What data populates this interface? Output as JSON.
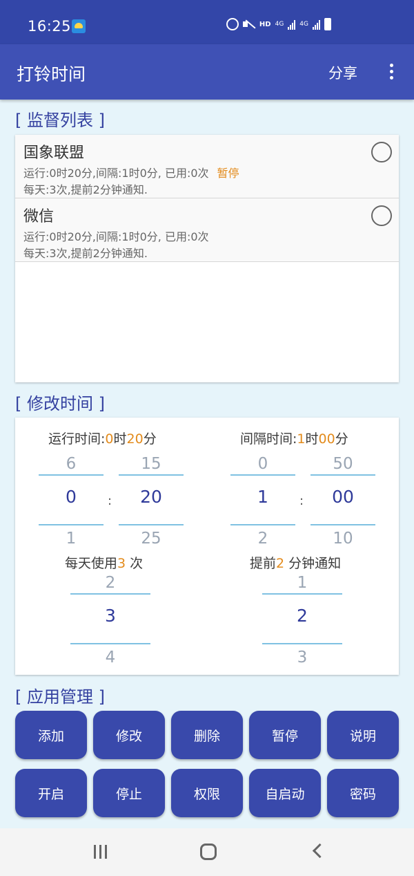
{
  "status_bar": {
    "time": "16:25",
    "hd": "HD",
    "net1": "4G",
    "net2": "4G"
  },
  "app_bar": {
    "title": "打铃时间",
    "share": "分享"
  },
  "monitor": {
    "title": "[ 监督列表 ]",
    "items": [
      {
        "name": "国象联盟",
        "line1": "运行:0时20分,间隔:1时0分, 已用:0次",
        "status": "暂停",
        "line2": "每天:3次,提前2分钟通知."
      },
      {
        "name": "微信",
        "line1": "运行:0时20分,间隔:1时0分, 已用:0次",
        "status": "",
        "line2": "每天:3次,提前2分钟通知."
      }
    ]
  },
  "edit": {
    "title": "[ 修改时间 ]",
    "run": {
      "label": "运行时间:",
      "h": "0",
      "h_unit": "时",
      "m": "20",
      "m_unit": "分"
    },
    "interval": {
      "label": "间隔时间:",
      "h": "1",
      "h_unit": "时",
      "m": "00",
      "m_unit": "分"
    },
    "colon": ":",
    "run_hour": {
      "prev": "6",
      "cur": "0",
      "next": "1"
    },
    "run_min": {
      "prev": "15",
      "cur": "20",
      "next": "25"
    },
    "int_hour": {
      "prev": "0",
      "cur": "1",
      "next": "2"
    },
    "int_min": {
      "prev": "50",
      "cur": "00",
      "next": "10"
    },
    "daily": {
      "pre": "每天使用",
      "num": "3",
      "post": " 次"
    },
    "advance": {
      "pre": "提前",
      "num": "2",
      "post": " 分钟通知"
    },
    "daily_picker": {
      "prev": "2",
      "cur": "3",
      "next": "4"
    },
    "advance_picker": {
      "prev": "1",
      "cur": "2",
      "next": "3"
    }
  },
  "manage": {
    "title": "[ 应用管理 ]",
    "buttons": [
      "添加",
      "修改",
      "删除",
      "暂停",
      "说明",
      "开启",
      "停止",
      "权限",
      "自启动",
      "密码"
    ]
  }
}
